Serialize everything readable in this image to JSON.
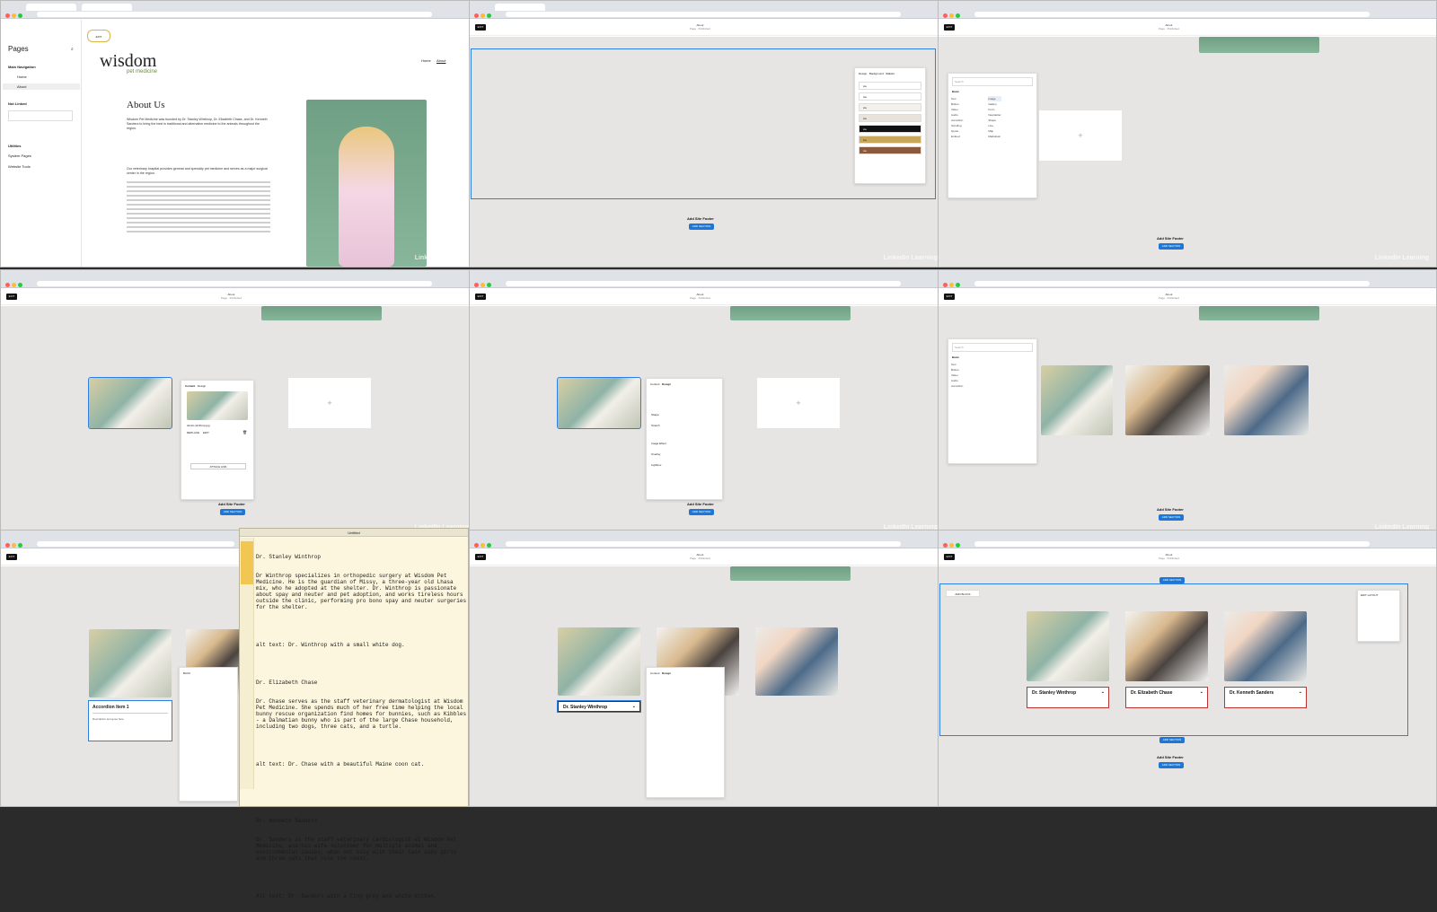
{
  "panel1": {
    "sidebar_title": "Pages",
    "main_nav": "Main Navigation",
    "nav_items": [
      "Home",
      "About"
    ],
    "not_linked": "Not Linked",
    "utilities": "Utilities",
    "utility_items": [
      "System Pages",
      "Website Tools"
    ],
    "logo_main": "wisdom",
    "logo_sub": "pet medicine",
    "site_nav": [
      "Home",
      "About"
    ],
    "heading": "About Us",
    "p1": "Wisdom Pet Medicine was founded by Dr. Stanley Winthrop, Dr. Elizabeth Chase, and Dr. Kenneth Sanders to bring the best in traditional and alternative medicine to the animals throughout the region.",
    "p2": "Our veterinary hospital provides general and specialty pet medicine and serves as a major surgical center in the region."
  },
  "toolbar": {
    "exit": "EXIT",
    "page_title": "About",
    "page_status": "Page · Published"
  },
  "panel2": {
    "tabs": [
      "Design",
      "Background",
      "Colors"
    ],
    "swatch_label": "Aa"
  },
  "footer": {
    "label": "Add Site Footer",
    "button": "ADD SECTION"
  },
  "blocks": {
    "search": "Search",
    "group": "Basic",
    "left": [
      "Text",
      "Button",
      "Video",
      "Audio",
      "Accordion",
      "Scrolling",
      "Quote",
      "Embed"
    ],
    "right": [
      "Image",
      "Gallery",
      "Form",
      "Newsletter",
      "Shape",
      "Line",
      "Map",
      "Markdown"
    ]
  },
  "panel4": {
    "tabs": [
      "Content",
      "Design"
    ],
    "filename": "doctor-winthrop.jpg",
    "replace": "REPLACE",
    "edit": "EDIT",
    "attach_link": "ATTACH LINK"
  },
  "panel5": {
    "tabs": [
      "Content",
      "Design"
    ],
    "rows": [
      "Shape",
      "Stretch",
      "Image Effect",
      "Overlay",
      "Lightbox"
    ]
  },
  "panel7": {
    "accordion_title": "Accordion Item 1",
    "accordion_body": "Description text goes here",
    "back": "BACK",
    "editor_title": "Untitled",
    "editor_lines": [
      "Dr. Stanley Winthrop",
      "Dr Winthrop specializes in orthopedic surgery at Wisdom Pet Medicine. He is the guardian of Missy, a three-year old Lhasa mix, who he adopted at the shelter. Dr. Winthrop is passionate about spay and neuter and pet adoption, and works tireless hours outside the clinic, performing pro bono spay and neuter surgeries for the shelter.",
      "",
      "alt text: Dr. Winthrop with a small white dog.",
      "",
      "Dr. Elizabeth Chase",
      "Dr. Chase serves as the staff veterinary dermatologist at Wisdom Pet Medicine. She spends much of her free time helping the local bunny rescue organization find homes for bunnies, such as Kibbles - a Dalmatian bunny who is part of the large Chase household, including two dogs, three cats, and a turtle.",
      "",
      "alt text: Dr. Chase with a beautiful Maine coon cat.",
      "",
      "",
      "Dr. Kenneth Sanders",
      "Dr. Sanders is the staff veterinary cardiologist at Wisdom Pet Medicine, and his wife volunteer for multiple animal and environmental causes, when not busy with their twin baby girls and three cats that rule the roost.",
      "",
      "Alt text: Dr. Sanders with a tiny grey and white kitten."
    ]
  },
  "panel8": {
    "accordion_title": "Dr. Stanley Winthrop",
    "tabs": [
      "Content",
      "Design"
    ]
  },
  "panel9": {
    "accordions": [
      "Dr. Stanley Winthrop",
      "Dr. Elizabeth Chase",
      "Dr. Kenneth Sanders"
    ],
    "edit_layout": "EDIT LAYOUT",
    "add_block": "ADD BLOCK",
    "add_section": "ADD SECTION"
  },
  "watermark": "LinkedIn Learning",
  "colors": {
    "accent": "#1c77d8",
    "accordion_border": "#b33333",
    "editor_bg": "#fbf6dd"
  }
}
